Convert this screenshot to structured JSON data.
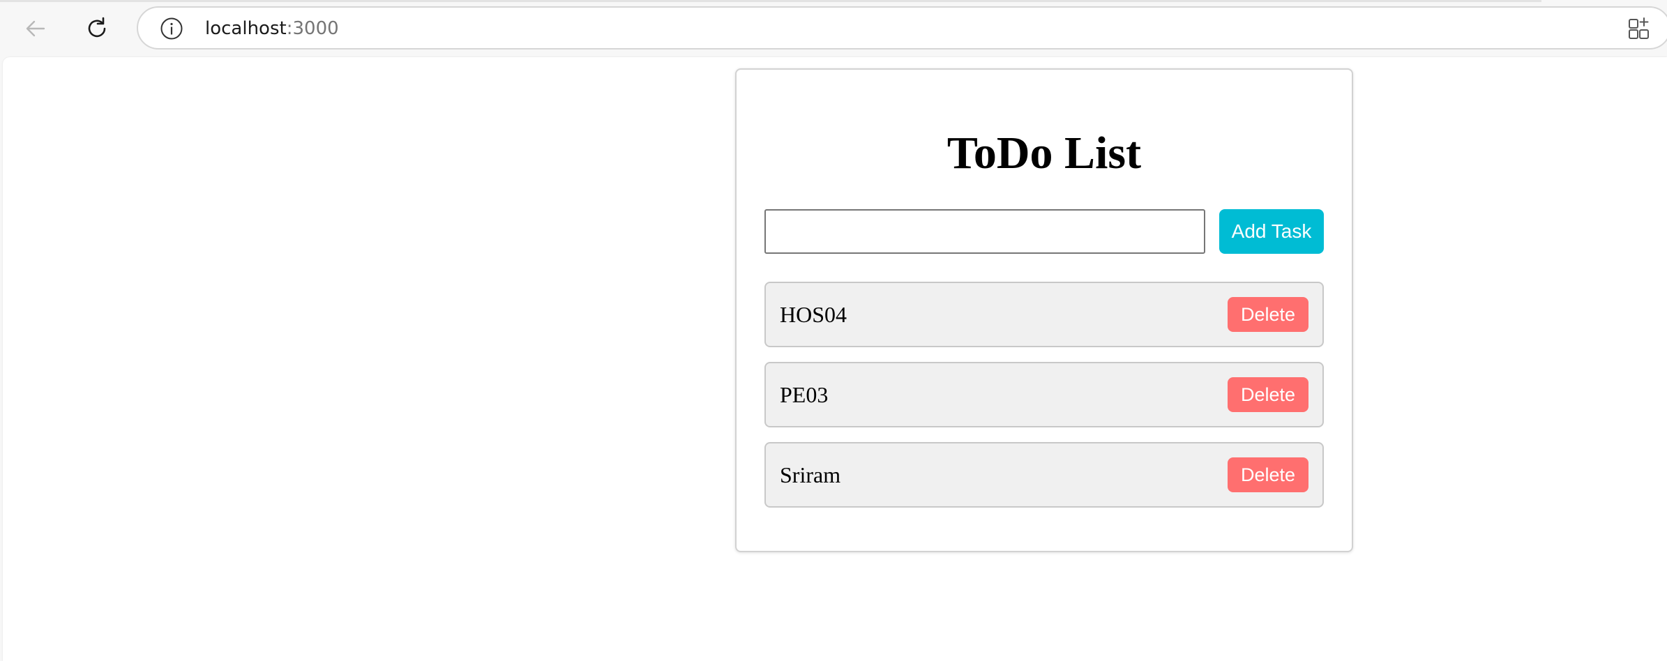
{
  "browser": {
    "url_host": "localhost",
    "url_port": ":3000",
    "icons": {
      "back": "back-arrow-icon",
      "reload": "reload-icon",
      "info": "info-icon",
      "apps": "add-app-icon"
    }
  },
  "app": {
    "title": "ToDo List",
    "input_value": "",
    "add_button_label": "Add Task",
    "tasks": [
      {
        "text": "HOS04",
        "delete_label": "Delete"
      },
      {
        "text": "PE03",
        "delete_label": "Delete"
      },
      {
        "text": "Sriram",
        "delete_label": "Delete"
      }
    ],
    "colors": {
      "add_button": "#00bcd4",
      "delete_button": "#ff6f6f",
      "task_background": "#f0f0f0"
    }
  }
}
